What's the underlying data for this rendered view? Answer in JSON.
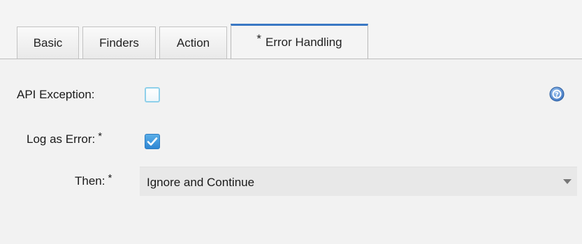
{
  "tabs": [
    {
      "label": "Basic",
      "active": false
    },
    {
      "label": "Finders",
      "active": false
    },
    {
      "label": "Action",
      "active": false
    },
    {
      "label": "Error Handling",
      "active": true,
      "marker": "*"
    }
  ],
  "form": {
    "api_exception": {
      "label": "API Exception:",
      "checked": false
    },
    "log_as_error": {
      "label": "Log as Error:",
      "required_marker": "*",
      "checked": true
    },
    "then": {
      "label": "Then:",
      "required_marker": "*",
      "value": "Ignore and Continue"
    }
  },
  "icons": {
    "help": "help-icon",
    "dropdown": "chevron-down-icon",
    "check": "check-icon"
  },
  "colors": {
    "accent": "#3a78c4",
    "checkbox_checked": "#2f86d3",
    "checkbox_unchecked_border": "#8fd0ea"
  }
}
